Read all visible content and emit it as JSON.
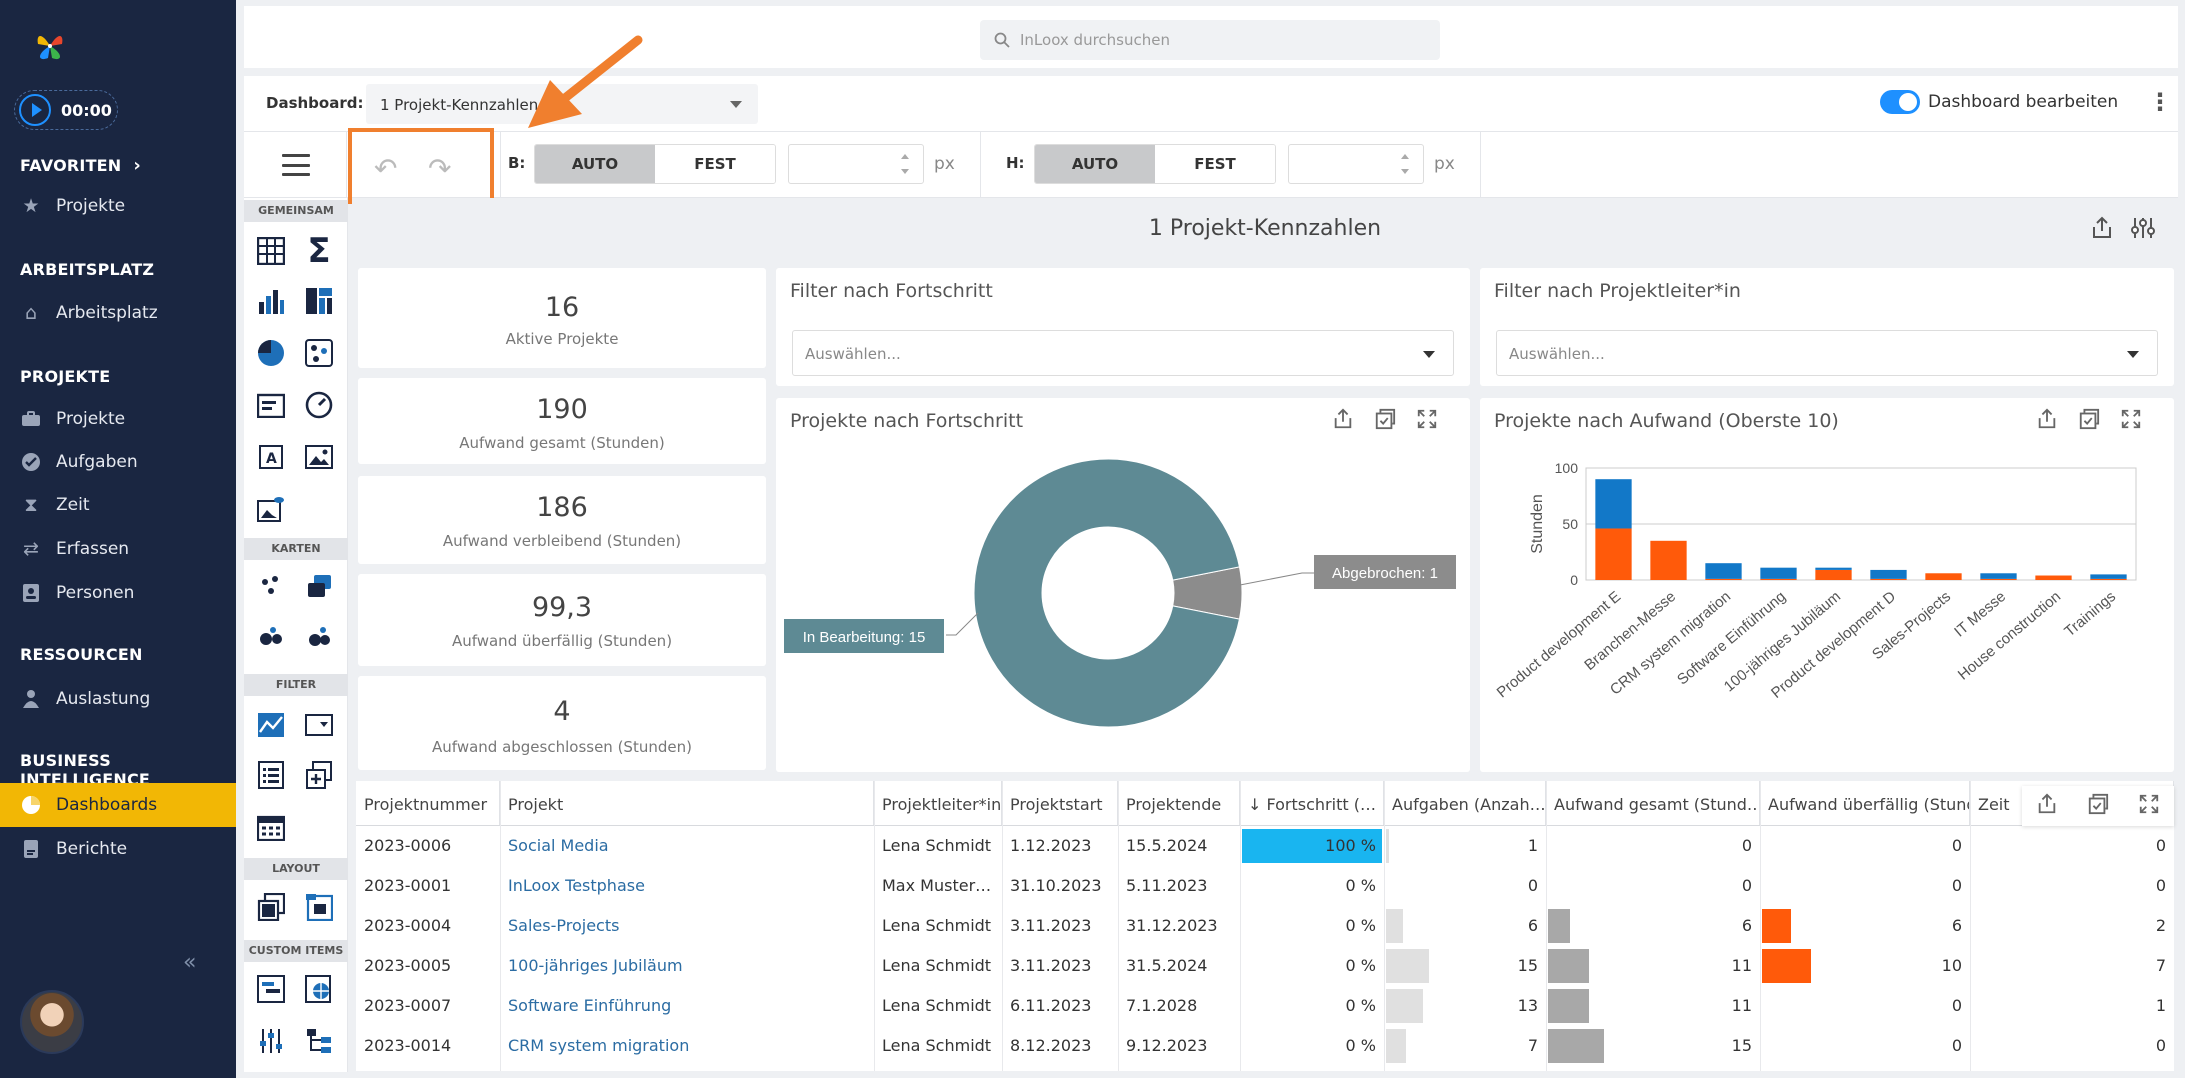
{
  "sidebar": {
    "timer": "00:00",
    "sections": [
      {
        "title": "FAVORITEN",
        "items": [
          {
            "label": "Projekte",
            "icon": "star-icon"
          }
        ]
      },
      {
        "title": "ARBEITSPLATZ",
        "items": [
          {
            "label": "Arbeitsplatz",
            "icon": "home-icon"
          }
        ]
      },
      {
        "title": "PROJEKTE",
        "items": [
          {
            "label": "Projekte",
            "icon": "briefcase-icon"
          },
          {
            "label": "Aufgaben",
            "icon": "check-circle-icon"
          },
          {
            "label": "Zeit",
            "icon": "hourglass-icon"
          },
          {
            "label": "Erfassen",
            "icon": "swap-icon"
          },
          {
            "label": "Personen",
            "icon": "contact-icon"
          }
        ]
      },
      {
        "title": "RESSOURCEN",
        "items": [
          {
            "label": "Auslastung",
            "icon": "user-load-icon"
          }
        ]
      },
      {
        "title": "BUSINESS INTELLIGENCE",
        "items": [
          {
            "label": "Dashboards",
            "icon": "pie-icon",
            "active": true
          },
          {
            "label": "Berichte",
            "icon": "report-icon"
          }
        ]
      }
    ],
    "accent": "#f2b705",
    "bg": "#1a2641"
  },
  "search": {
    "placeholder": "InLoox durchsuchen"
  },
  "dashboard_bar": {
    "label": "Dashboard:",
    "selected": "1 Projekt-Kennzahlen",
    "edit_toggle_label": "Dashboard bearbeiten",
    "edit_on": true
  },
  "toolbar": {
    "width_label": "B:",
    "height_label": "H:",
    "auto": "AUTO",
    "fest": "FEST",
    "unit": "px",
    "highlight_color": "#f07f2e"
  },
  "palette": {
    "sections": [
      "GEMEINSAM",
      "KARTEN",
      "FILTER",
      "LAYOUT",
      "CUSTOM ITEMS"
    ]
  },
  "page": {
    "title": "1 Projekt-Kennzahlen"
  },
  "kpis": [
    {
      "value": "16",
      "label": "Aktive Projekte"
    },
    {
      "value": "190",
      "label": "Aufwand gesamt (Stunden)"
    },
    {
      "value": "186",
      "label": "Aufwand verbleibend (Stunden)"
    },
    {
      "value": "99,3",
      "label": "Aufwand überfällig (Stunden)"
    },
    {
      "value": "4",
      "label": "Aufwand abgeschlossen (Stunden)"
    }
  ],
  "filters": [
    {
      "title": "Filter nach Fortschritt",
      "placeholder": "Auswählen..."
    },
    {
      "title": "Filter nach Projektleiter*in",
      "placeholder": "Auswählen..."
    }
  ],
  "chart_data": [
    {
      "type": "pie",
      "title": "Projekte nach Fortschritt",
      "donut": true,
      "categories": [
        "In Bearbeitung",
        "Abgebrochen"
      ],
      "values": [
        15,
        1
      ],
      "labels": [
        "In Bearbeitung: 15",
        "Abgebrochen: 1"
      ],
      "colors": [
        "#5e8a94",
        "#8c8c8c"
      ]
    },
    {
      "type": "bar",
      "stacked": true,
      "title": "Projekte nach Aufwand (Oberste 10)",
      "ylabel": "Stunden",
      "ylim": [
        0,
        100
      ],
      "yticks": [
        0,
        50,
        100
      ],
      "categories": [
        "Product development E",
        "Branchen-Messe",
        "CRM system migration",
        "Software Einführung",
        "100-jähriges Jubiläum",
        "Product development D",
        "Sales-Projects",
        "IT Messe",
        "House construction",
        "Trainings"
      ],
      "series": [
        {
          "values": [
            46,
            35,
            1,
            1,
            9,
            1,
            6,
            1,
            4,
            1
          ],
          "color": "#ff5a0a"
        },
        {
          "values": [
            44,
            0,
            14,
            10,
            2,
            8,
            0,
            5,
            0,
            4
          ],
          "color": "#1278c8"
        }
      ]
    }
  ],
  "table": {
    "columns": [
      "Projektnummer",
      "Projekt",
      "Projektleiter*in",
      "Projektstart",
      "Projektende",
      "Fortschritt (…",
      "Aufgaben (Anzah…",
      "Aufwand gesamt (Stund…",
      "Aufwand überfällig (Stund…",
      "Zeit"
    ],
    "sort_icon": "arrow-down-icon",
    "rows": [
      {
        "nr": "2023-0006",
        "projekt": "Social Media",
        "leiter": "Lena Schmidt",
        "start": "1.12.2023",
        "ende": "15.5.2024",
        "fortschritt": "100 %",
        "fortschritt_frac": 1.0,
        "aufgaben": "1",
        "aufgaben_val": 1,
        "aufwand": "0",
        "aufwand_val": 0,
        "ueberfaellig": "0",
        "ueberfaellig_val": 0,
        "zeit": "0"
      },
      {
        "nr": "2023-0001",
        "projekt": "InLoox Testphase",
        "leiter": "Max Muster…",
        "start": "31.10.2023",
        "ende": "5.11.2023",
        "fortschritt": "0 %",
        "fortschritt_frac": 0,
        "aufgaben": "0",
        "aufgaben_val": 0,
        "aufwand": "0",
        "aufwand_val": 0,
        "ueberfaellig": "0",
        "ueberfaellig_val": 0,
        "zeit": "0"
      },
      {
        "nr": "2023-0004",
        "projekt": "Sales-Projects",
        "leiter": "Lena Schmidt",
        "start": "3.11.2023",
        "ende": "31.12.2023",
        "fortschritt": "0 %",
        "fortschritt_frac": 0,
        "aufgaben": "6",
        "aufgaben_val": 6,
        "aufwand": "6",
        "aufwand_val": 6,
        "ueberfaellig": "6",
        "ueberfaellig_val": 6,
        "zeit": "2"
      },
      {
        "nr": "2023-0005",
        "projekt": "100-jähriges Jubiläum",
        "leiter": "Lena Schmidt",
        "start": "3.11.2023",
        "ende": "31.5.2024",
        "fortschritt": "0 %",
        "fortschritt_frac": 0,
        "aufgaben": "15",
        "aufgaben_val": 15,
        "aufwand": "11",
        "aufwand_val": 11,
        "ueberfaellig": "10",
        "ueberfaellig_val": 10,
        "zeit": "7"
      },
      {
        "nr": "2023-0007",
        "projekt": "Software Einführung",
        "leiter": "Lena Schmidt",
        "start": "6.11.2023",
        "ende": "7.1.2028",
        "fortschritt": "0 %",
        "fortschritt_frac": 0,
        "aufgaben": "13",
        "aufgaben_val": 13,
        "aufwand": "11",
        "aufwand_val": 11,
        "ueberfaellig": "0",
        "ueberfaellig_val": 0,
        "zeit": "1"
      },
      {
        "nr": "2023-0014",
        "projekt": "CRM system migration",
        "leiter": "Lena Schmidt",
        "start": "8.12.2023",
        "ende": "9.12.2023",
        "fortschritt": "0 %",
        "fortschritt_frac": 0,
        "aufgaben": "7",
        "aufgaben_val": 7,
        "aufwand": "15",
        "aufwand_val": 15,
        "ueberfaellig": "0",
        "ueberfaellig_val": 0,
        "zeit": "0"
      }
    ]
  }
}
